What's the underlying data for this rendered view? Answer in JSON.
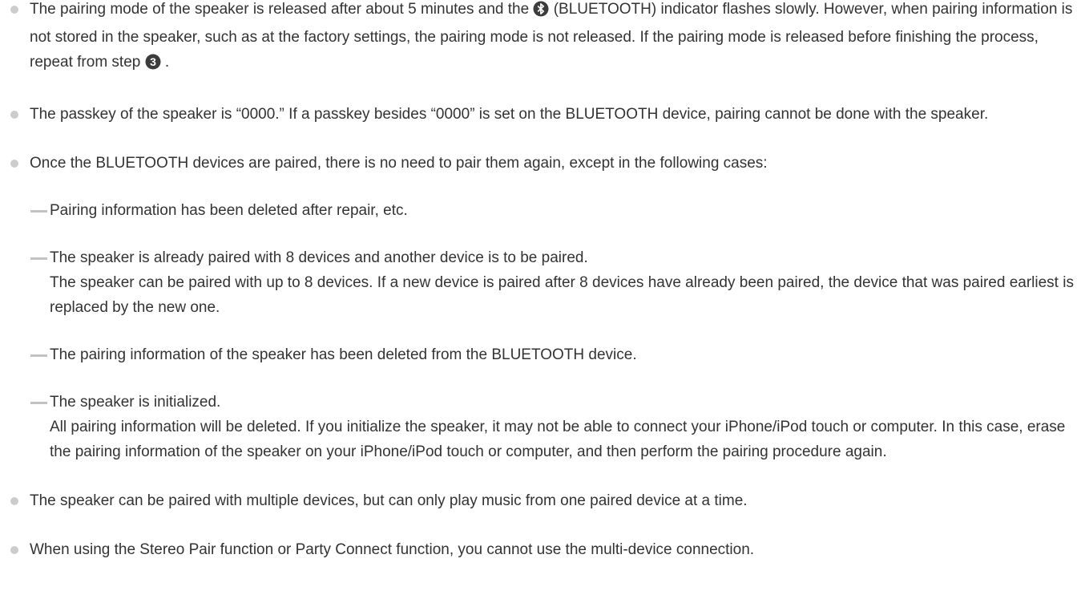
{
  "notes": {
    "note1": {
      "part1": "The pairing mode of the speaker is released after about 5 minutes and the ",
      "icon": "bluetooth-icon",
      "part2": " (BLUETOOTH) indicator flashes slowly. However, when pairing information is not stored in the speaker, such as at the factory settings, the pairing mode is not released. If the pairing mode is released before finishing the process, repeat from step ",
      "step_number": "3",
      "part3": " ."
    },
    "note2": "The passkey of the speaker is “0000.” If a passkey besides “0000” is set on the BLUETOOTH device, pairing cannot be done with the speaker.",
    "note3": {
      "text": "Once the BLUETOOTH devices are paired, there is no need to pair them again, except in the following cases:",
      "cases": [
        {
          "title": "Pairing information has been deleted after repair, etc."
        },
        {
          "title": "The speaker is already paired with 8 devices and another device is to be paired.",
          "detail": "The speaker can be paired with up to 8 devices. If a new device is paired after 8 devices have already been paired, the device that was paired earliest is replaced by the new one."
        },
        {
          "title": "The pairing information of the speaker has been deleted from the BLUETOOTH device."
        },
        {
          "title": "The speaker is initialized.",
          "detail": "All pairing information will be deleted. If you initialize the speaker, it may not be able to connect your iPhone/iPod touch or computer. In this case, erase the pairing information of the speaker on your iPhone/iPod touch or computer, and then perform the pairing procedure again."
        }
      ]
    },
    "note4": "The speaker can be paired with multiple devices, but can only play music from one paired device at a time.",
    "note5": "When using the Stereo Pair function or Party Connect function, you cannot use the multi-device connection."
  },
  "colors": {
    "text": "#333333",
    "bullet": "#cccccc",
    "dash": "#c2c2c2",
    "icon": "#3c3c3c"
  }
}
